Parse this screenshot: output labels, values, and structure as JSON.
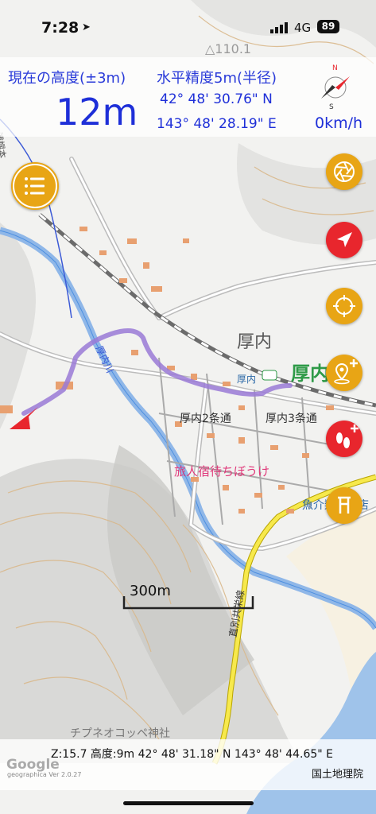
{
  "status_bar": {
    "time": "7:28",
    "network": "4G",
    "battery": "89"
  },
  "hud": {
    "altitude_label": "現在の高度(±3m)",
    "altitude_value": "12m",
    "accuracy_label": "水平精度5m(半径)",
    "latitude": "42° 48' 30.76\" N",
    "longitude": "143° 48' 28.19\" E",
    "speed": "0km/h"
  },
  "compass": {
    "north": "N",
    "south": "S"
  },
  "map_labels": {
    "peak": "△110.1",
    "area_atsunai": "厚内",
    "station_big": "厚内駅",
    "station_small": "厚内",
    "street_2": "厚内2条通",
    "street_3": "厚内3条通",
    "inn": "旅人宿待ちぼうけ",
    "shop": "魚介類販売店",
    "shrine": "チプネオコッペ神社",
    "river": "厚内川",
    "road_left": "浦幌本",
    "rail_line": "直別共栄線"
  },
  "scale_bar": {
    "label": "300m"
  },
  "bottom_bar": {
    "info": "Z:15.7 高度:9m  42° 48' 31.18\" N 143° 48' 44.65\" E",
    "attribution": "国土地理院",
    "google": "Google",
    "version": "geographica Ver 2.0.27"
  },
  "icons": {
    "menu": "list-icon",
    "layer": "shutter-icon",
    "navigate": "navigation-arrow-icon",
    "locate": "crosshair-icon",
    "add_point": "add-pin-icon",
    "add_track": "add-footprint-icon",
    "flag": "flag-icon"
  },
  "colors": {
    "accent_yellow": "#e8a515",
    "accent_red": "#e8262d",
    "hud_blue": "#1e2fd8",
    "track": "#9a7ad6"
  }
}
